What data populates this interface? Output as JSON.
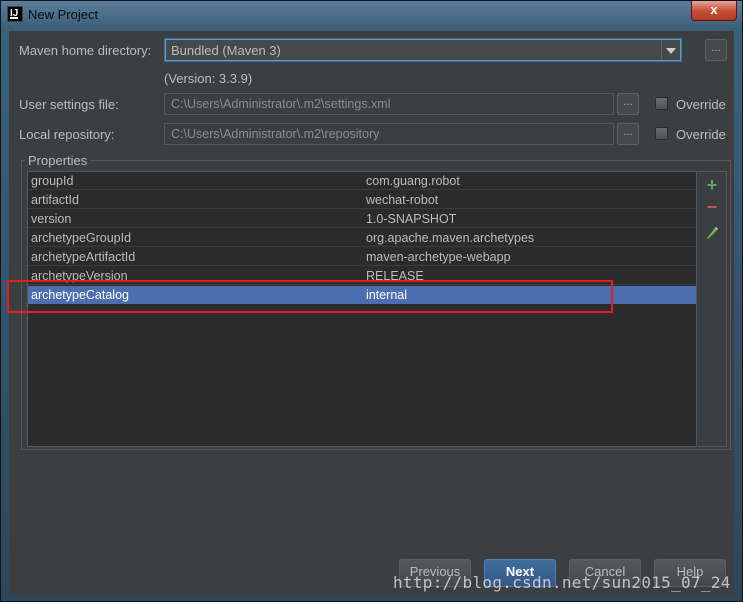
{
  "window": {
    "title": "New Project",
    "close_glyph": "x"
  },
  "maven": {
    "home_label": "Maven home directory:",
    "home_value": "Bundled (Maven 3)",
    "version": "(Version: 3.3.9)",
    "settings_label": "User settings file:",
    "settings_value": "C:\\Users\\Administrator\\.m2\\settings.xml",
    "repo_label": "Local repository:",
    "repo_value": "C:\\Users\\Administrator\\.m2\\repository",
    "override_label": "Override",
    "browse_label": "..."
  },
  "properties": {
    "title": "Properties",
    "rows": [
      {
        "key": "groupId",
        "value": "com.guang.robot"
      },
      {
        "key": "artifactId",
        "value": "wechat-robot"
      },
      {
        "key": "version",
        "value": "1.0-SNAPSHOT"
      },
      {
        "key": "archetypeGroupId",
        "value": "org.apache.maven.archetypes"
      },
      {
        "key": "archetypeArtifactId",
        "value": "maven-archetype-webapp"
      },
      {
        "key": "archetypeVersion",
        "value": "RELEASE"
      },
      {
        "key": "archetypeCatalog",
        "value": "internal"
      }
    ],
    "selected_row": "archetypeCatalog",
    "tools": {
      "add_glyph": "+",
      "remove_glyph": "−"
    }
  },
  "buttons": {
    "previous": "Previous",
    "next": "Next",
    "cancel": "Cancel",
    "help": "Help"
  },
  "watermark": "http://blog.csdn.net/sun2015_07_24",
  "colors": {
    "selection": "#4b6eaf",
    "accent": "#5b9bd5",
    "highlight_box": "#e02020",
    "add": "#59a869",
    "remove": "#c75450"
  },
  "icons": [
    "intellij-app-icon",
    "close-icon",
    "chevron-down-icon",
    "add-icon",
    "remove-icon",
    "edit-pencil-icon"
  ]
}
